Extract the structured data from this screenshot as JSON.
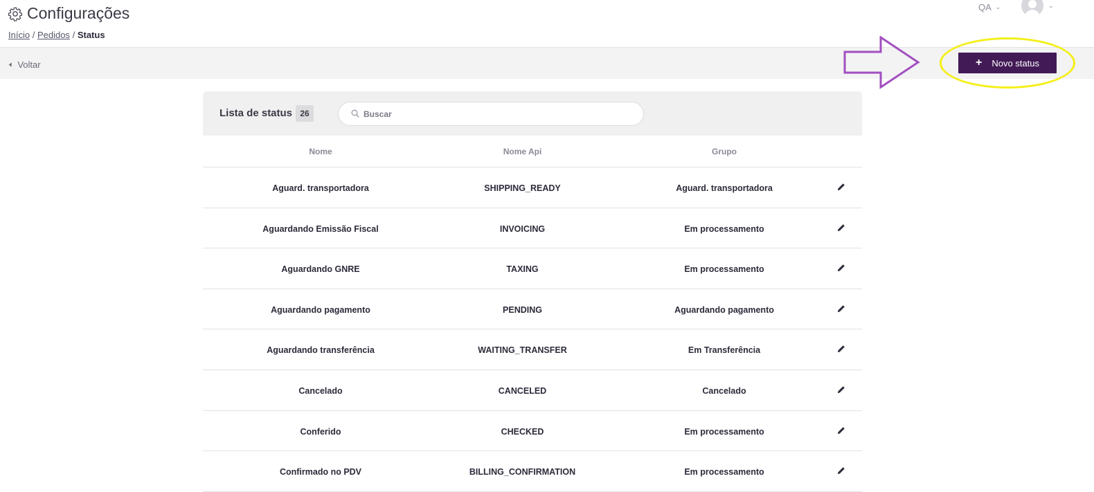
{
  "header": {
    "title": "Configurações",
    "breadcrumb": {
      "home": "Início",
      "separator": "/",
      "orders": "Pedidos",
      "current": "Status"
    },
    "environment": "QA"
  },
  "toolbar": {
    "back_label": "Voltar",
    "new_button_label": "Novo status"
  },
  "list": {
    "title": "Lista de status",
    "count": "26",
    "search_placeholder": "Buscar",
    "columns": [
      "Nome",
      "Nome Api",
      "Grupo"
    ],
    "rows": [
      {
        "name": "Aguard. transportadora",
        "api": "SHIPPING_READY",
        "group": "Aguard. transportadora"
      },
      {
        "name": "Aguardando Emissão Fiscal",
        "api": "INVOICING",
        "group": "Em processamento"
      },
      {
        "name": "Aguardando GNRE",
        "api": "TAXING",
        "group": "Em processamento"
      },
      {
        "name": "Aguardando pagamento",
        "api": "PENDING",
        "group": "Aguardando pagamento"
      },
      {
        "name": "Aguardando transferência",
        "api": "WAITING_TRANSFER",
        "group": "Em Transferência"
      },
      {
        "name": "Cancelado",
        "api": "CANCELED",
        "group": "Cancelado"
      },
      {
        "name": "Conferido",
        "api": "CHECKED",
        "group": "Em processamento"
      },
      {
        "name": "Confirmado no PDV",
        "api": "BILLING_CONFIRMATION",
        "group": "Em processamento"
      }
    ]
  },
  "icons": {
    "settings": "gear-icon",
    "back": "arrow-left-icon",
    "plus": "plus-icon",
    "search": "search-icon",
    "edit": "pencil-icon",
    "avatar": "user-avatar-icon",
    "annotation_arrow": "arrow-right-outline",
    "annotation_highlight": "ellipse-highlight"
  },
  "colors": {
    "brand": "#421a56",
    "annotation_arrow": "#a24fc0",
    "annotation_highlight": "#f4ef19"
  }
}
